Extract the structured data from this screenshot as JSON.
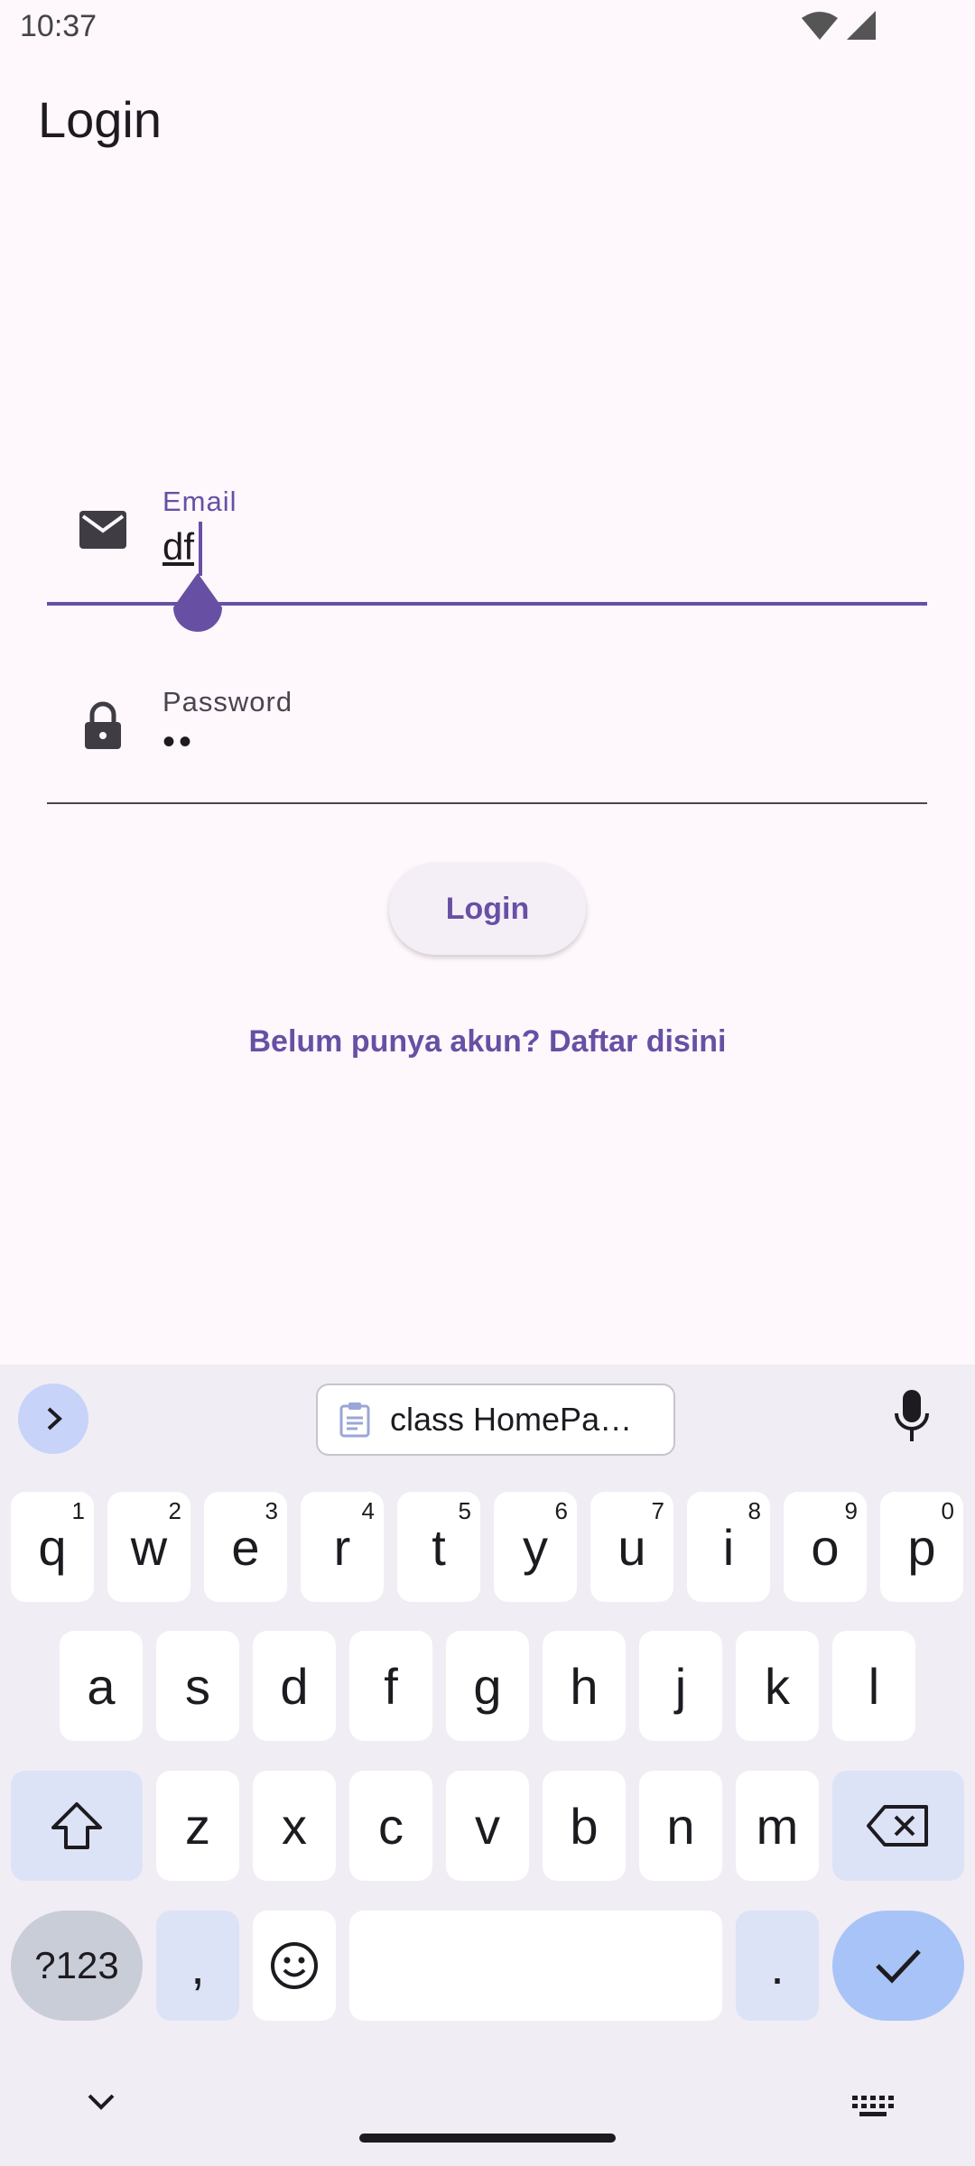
{
  "status_bar": {
    "time": "10:37"
  },
  "app_bar": {
    "title": "Login"
  },
  "form": {
    "email": {
      "label": "Email",
      "value": "df"
    },
    "password": {
      "label": "Password",
      "value": "••"
    },
    "login_button": "Login",
    "register_link": "Belum punya akun? Daftar disini"
  },
  "keyboard": {
    "clipboard_chip": "class HomePa…",
    "row1": [
      {
        "key": "q",
        "hint": "1"
      },
      {
        "key": "w",
        "hint": "2"
      },
      {
        "key": "e",
        "hint": "3"
      },
      {
        "key": "r",
        "hint": "4"
      },
      {
        "key": "t",
        "hint": "5"
      },
      {
        "key": "y",
        "hint": "6"
      },
      {
        "key": "u",
        "hint": "7"
      },
      {
        "key": "i",
        "hint": "8"
      },
      {
        "key": "o",
        "hint": "9"
      },
      {
        "key": "p",
        "hint": "0"
      }
    ],
    "row2": [
      "a",
      "s",
      "d",
      "f",
      "g",
      "h",
      "j",
      "k",
      "l"
    ],
    "row3": [
      "z",
      "x",
      "c",
      "v",
      "b",
      "n",
      "m"
    ],
    "symbols_key": "?123",
    "comma_key": ",",
    "period_key": "."
  },
  "colors": {
    "accent": "#6750a4",
    "background": "#fef7fc",
    "enter_key": "#a8c3f7"
  }
}
